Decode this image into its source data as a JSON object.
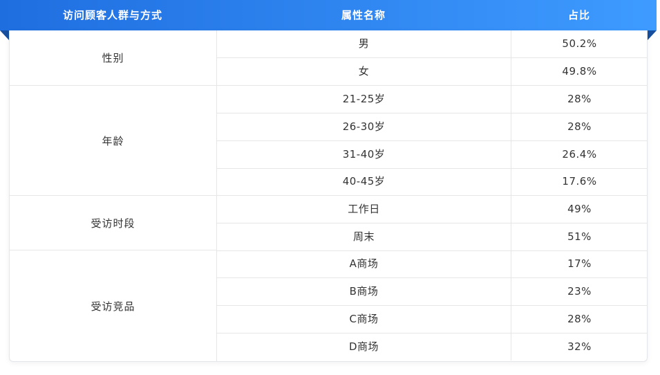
{
  "header": {
    "col1": "访问顾客人群与方式",
    "col2": "属性名称",
    "col3": "占比"
  },
  "groups": [
    {
      "label": "性别",
      "rows": [
        {
          "name": "男",
          "pct": "50.2%"
        },
        {
          "name": "女",
          "pct": "49.8%"
        }
      ]
    },
    {
      "label": "年龄",
      "rows": [
        {
          "name": "21-25岁",
          "pct": "28%"
        },
        {
          "name": "26-30岁",
          "pct": "28%"
        },
        {
          "name": "31-40岁",
          "pct": "26.4%"
        },
        {
          "name": "40-45岁",
          "pct": "17.6%"
        }
      ]
    },
    {
      "label": "受访时段",
      "rows": [
        {
          "name": "工作日",
          "pct": "49%"
        },
        {
          "name": "周末",
          "pct": "51%"
        }
      ]
    },
    {
      "label": "受访竞品",
      "rows": [
        {
          "name": "A商场",
          "pct": "17%"
        },
        {
          "name": "B商场",
          "pct": "23%"
        },
        {
          "name": "C商场",
          "pct": "28%"
        },
        {
          "name": "D商场",
          "pct": "32%"
        }
      ]
    }
  ],
  "colors": {
    "header_start": "#1f6ee0",
    "header_end": "#3e9bff",
    "fold": "#174f9e",
    "border": "#e6e6e6",
    "text": "#333333"
  }
}
